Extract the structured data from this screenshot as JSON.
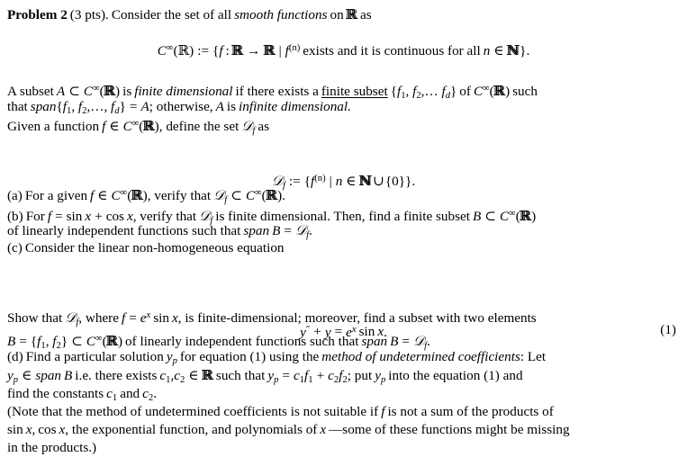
{
  "document": {
    "type": "math-homework-problem",
    "problem_heading": "Problem 2",
    "points": "(3 pts).",
    "intro_text": "Consider the set of all smooth functions on ℝ as",
    "background_color": "#ffffff",
    "text_color": "#000000"
  },
  "lines": {
    "intro_lead": "Problem 2",
    "intro_pts": "(3 pts).",
    "intro_rest_a": "Consider the set of all",
    "intro_emph": "smooth functions",
    "intro_rest_b": "on",
    "intro_rest_c": "as"
  },
  "display_eq_1": {
    "text": "C∞(ℝ) := {f : ℝ → ℝ | f⁽ⁿ⁾ exists and it is continuous for all n ∈ ℕ}.",
    "lhs": "C",
    "lhs_sup": "∞",
    "lhs_arg": "(ℝ)",
    "assign": ":=",
    "set_open": "{",
    "f": "f",
    "colon": ":",
    "domain": "ℝ",
    "arrow": "→",
    "codomain": "ℝ",
    "bar": "|",
    "fn": "f",
    "fn_sup": "(n)",
    "condition": "exists and it is continuous for all",
    "n": "n",
    "in": "∈",
    "naturals": "ℕ",
    "set_close": "}",
    "period": "."
  },
  "para_def": {
    "t1": "A subset",
    "A": "A",
    "subset": "⊂",
    "Cinf": "C",
    "inf": "∞",
    "R": "(ℝ)",
    "t2": "is",
    "emph1": "finite dimensional",
    "t3": "if there exists a",
    "underlined": "finite subset",
    "set1": "{f1, f2,… fd}",
    "t4": "of",
    "t5": "such",
    "t6": "that",
    "span": "span",
    "set2": "{f1, f2,…, fd}",
    "eq": "=",
    "A2": "A",
    "semicolon": "; otherwise,",
    "A3": "A",
    "t7": "is",
    "emph2": "infinite dimensional.",
    "t8": "Given a function",
    "f": "f",
    "elem": "∈",
    "t9": ", define the set",
    "Df": "𝒟",
    "Df_sub": "f",
    "t10": "as"
  },
  "display_eq_2": {
    "D": "𝒟",
    "D_sub": "f",
    "assign": ":=",
    "open": "{",
    "f": "f",
    "f_sup": "(n)",
    "bar": "|",
    "n": "n",
    "in": "∈",
    "N": "ℕ",
    "cup": "∪",
    "zero": "{0}",
    "close": "}",
    "period": "."
  },
  "item_a": {
    "label": "(a)",
    "text_1": "For a given",
    "f": "f",
    "in": "∈",
    "Cinf": "C",
    "inf": "∞",
    "R": "(ℝ)",
    "text_2": ", verify that",
    "Df": "𝒟",
    "Df_sub": "f",
    "subset": "⊂",
    "text_3": "."
  },
  "item_b": {
    "label": "(b)",
    "text_1": "For",
    "f": "f",
    "eq": "=",
    "sinx": "sin x",
    "plus": "+",
    "cosx": "cos x",
    "text_2": ", verify that",
    "Df": "𝒟",
    "Df_sub": "f",
    "text_3": "is finite dimensional.  Then, find a finite subset",
    "B": "B",
    "subset": "⊂",
    "Cinf": "C∞(ℝ)",
    "text_4": "of linearly independent functions such that",
    "span": "span",
    "B2": "B",
    "eq2": "=",
    "Df2": "𝒟",
    "Df2_sub": "f",
    "period": "."
  },
  "item_c": {
    "label": "(c)",
    "text": "Consider the linear non-homogeneous equation"
  },
  "display_eq_3": {
    "y": "y",
    "y_sup": "″",
    "plus": "+",
    "y2": "y",
    "eq": "=",
    "e": "e",
    "e_sup": "x",
    "sinx": "sin x",
    "period": ".",
    "number": "(1)"
  },
  "para_show": {
    "t1": "Show that",
    "D": "𝒟",
    "D_sub": "f",
    "t2": ", where",
    "f": "f",
    "eq": "=",
    "e": "e",
    "e_sup": "x",
    "sinx": "sin x",
    "t3": ", is finite-dimensional; moreover, find a subset with two elements",
    "B": "B",
    "eq2": "=",
    "set": "{f1, f2}",
    "subset": "⊂",
    "Cinf": "C∞(ℝ)",
    "t4": "of linearly independent functions such that",
    "span": "span",
    "B2": "B",
    "eq3": "=",
    "D2": "𝒟",
    "D2_sub": "f",
    "period": "."
  },
  "item_d": {
    "label": "(d)",
    "t1": "Find a particular solution",
    "yp": "y",
    "yp_sub": "p",
    "t2": "for equation (1) using the",
    "emph": "method of undetermined coefficients",
    "t3": ": Let",
    "yp2": "y",
    "yp2_sub": "p",
    "in": "∈",
    "span": "span",
    "B": "B",
    "t4": "i.e.  there exists",
    "c1": "c",
    "c1_sub": "1",
    "comma": ",",
    "c2": "c",
    "c2_sub": "2",
    "in2": "∈",
    "R": "ℝ",
    "t5": "such that",
    "yp3": "y",
    "yp3_sub": "p",
    "eq": "=",
    "c1f1": "c1f1",
    "plus": "+",
    "c2f2": "c2f2",
    "t6": "; put",
    "yp4": "y",
    "yp4_sub": "p",
    "t7": "into the equation (1) and find the constants",
    "c1b": "c",
    "c1b_sub": "1",
    "and": "and",
    "c2b": "c",
    "c2b_sub": "2",
    "period": "."
  },
  "para_note": {
    "t1": "(Note that the method of undetermined coefficients is not suitable if",
    "f": "f",
    "t2": "is not a sum of the products of",
    "sinx": "sin x",
    "comma": ",",
    "cosx": "cos x",
    "t3": ", the exponential function, and polynomials of",
    "x": "x",
    "dash": "—some of these functions might be missing in the products.)"
  }
}
